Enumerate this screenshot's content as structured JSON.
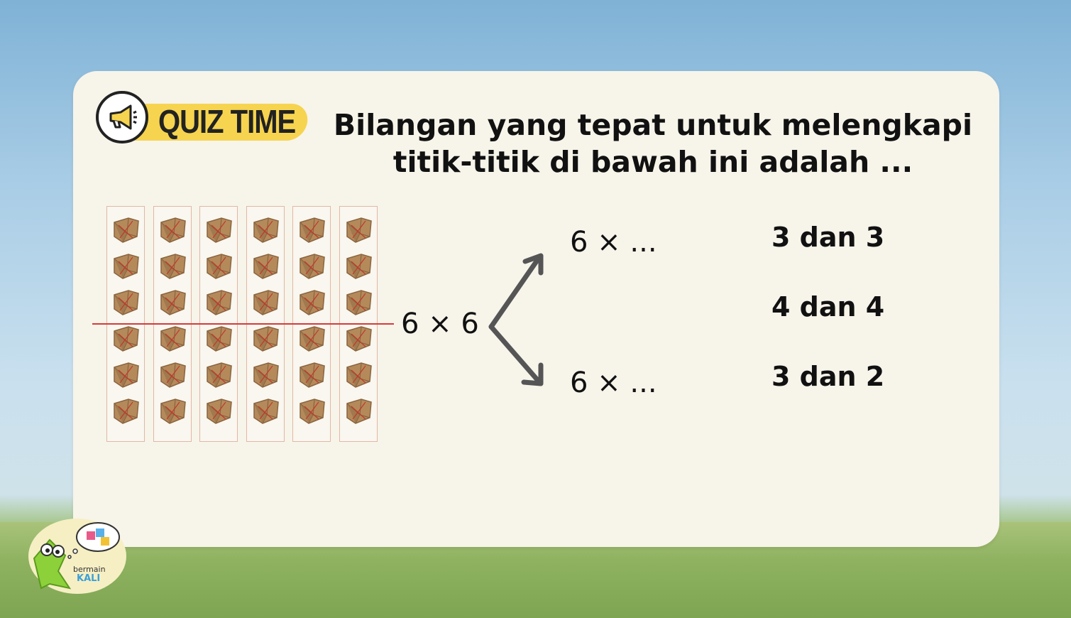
{
  "badge": {
    "label": "QUIZ TIME",
    "icon": "megaphone-icon"
  },
  "question": {
    "line1": "Bilangan yang tepat untuk melengkapi",
    "line2": "titik-titik di bawah ini adalah ..."
  },
  "diagram": {
    "main_expr": "6 × 6",
    "top_expr": "6 × ...",
    "bottom_expr": "6 × ...",
    "grid_columns": 6,
    "grid_rows": 6,
    "split_after_row": 3
  },
  "options": [
    {
      "label": "3 dan 3"
    },
    {
      "label": "4 dan 4"
    },
    {
      "label": "3 dan 2"
    }
  ],
  "logo": {
    "line1": "bermain",
    "line2": "KALI"
  },
  "colors": {
    "badge": "#f6d44f",
    "divider": "#d83a3a",
    "parcel": "#b58a5b",
    "card": "#f7f4ea"
  }
}
